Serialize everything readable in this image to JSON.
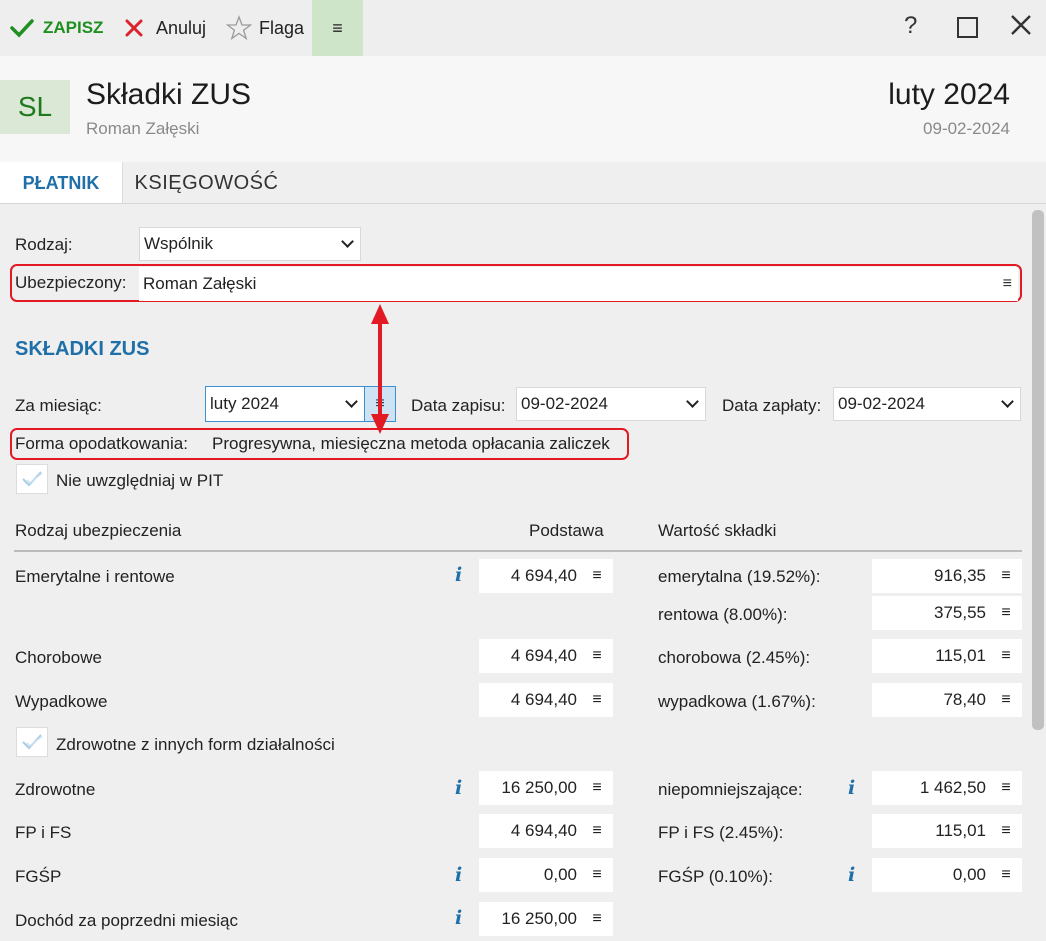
{
  "toolbar": {
    "save_label": "ZAPISZ",
    "cancel_label": "Anuluj",
    "flag_label": "Flaga",
    "menu_glyph": "≡",
    "help_glyph": "?",
    "maximize_glyph": "□",
    "close_glyph": "✕"
  },
  "header": {
    "badge": "SL",
    "title": "Składki ZUS",
    "subtitle": "Roman Załęski",
    "period": "luty 2024",
    "date": "09-02-2024"
  },
  "tabs": [
    {
      "label": "PŁATNIK",
      "active": true
    },
    {
      "label": "KSIĘGOWOŚĆ",
      "active": false
    }
  ],
  "form": {
    "rodzaj_label": "Rodzaj:",
    "rodzaj_value": "Wspólnik",
    "ubezpieczony_label": "Ubezpieczony:",
    "ubezpieczony_value": "Roman Załęski"
  },
  "skladki": {
    "section_title": "SKŁADKI ZUS",
    "za_miesiac_label": "Za miesiąc:",
    "za_miesiac_value": "luty 2024",
    "data_zapisu_label": "Data zapisu:",
    "data_zapisu_value": "09-02-2024",
    "data_zaplaty_label": "Data zapłaty:",
    "data_zaplaty_value": "09-02-2024",
    "forma_label": "Forma opodatkowania:",
    "forma_value": "Progresywna, miesięczna metoda opłacania zaliczek",
    "pit_checkbox_label": "Nie uwzględniaj w PIT",
    "zdrowotne_checkbox_label": "Zdrowotne z innych form działalności"
  },
  "table": {
    "col_type": "Rodzaj ubezpieczenia",
    "col_base": "Podstawa",
    "col_value": "Wartość składki",
    "rows": {
      "emerytalne": {
        "label": "Emerytalne i rentowe",
        "base": "4 694,40"
      },
      "chorobowe": {
        "label": "Chorobowe",
        "base": "4 694,40"
      },
      "wypadkowe": {
        "label": "Wypadkowe",
        "base": "4 694,40"
      },
      "zdrowotne": {
        "label": "Zdrowotne",
        "base": "16 250,00"
      },
      "fpfs": {
        "label": "FP i FS",
        "base": "4 694,40"
      },
      "fgsp": {
        "label": "FGŚP",
        "base": "0,00"
      },
      "dochod": {
        "label": "Dochód za poprzedni miesiąc",
        "base": "16 250,00"
      }
    },
    "values": {
      "emerytalna": {
        "label": "emerytalna (19.52%):",
        "value": "916,35"
      },
      "rentowa": {
        "label": "rentowa (8.00%):",
        "value": "375,55"
      },
      "chorobowa": {
        "label": "chorobowa (2.45%):",
        "value": "115,01"
      },
      "wypadkowa": {
        "label": "wypadkowa (1.67%):",
        "value": "78,40"
      },
      "niepomniejszajace": {
        "label": "niepomniejszające:",
        "value": "1 462,50"
      },
      "fpfs": {
        "label": "FP i FS (2.45%):",
        "value": "115,01"
      },
      "fgsp": {
        "label": "FGŚP (0.10%):",
        "value": "0,00"
      }
    }
  },
  "icons": {
    "info": "i",
    "hamburger": "≡"
  },
  "colors": {
    "accent_blue": "#1f6fa8",
    "save_green": "#1f8f1f",
    "cancel_red": "#d9242b",
    "annotation_red": "#e11a23"
  }
}
